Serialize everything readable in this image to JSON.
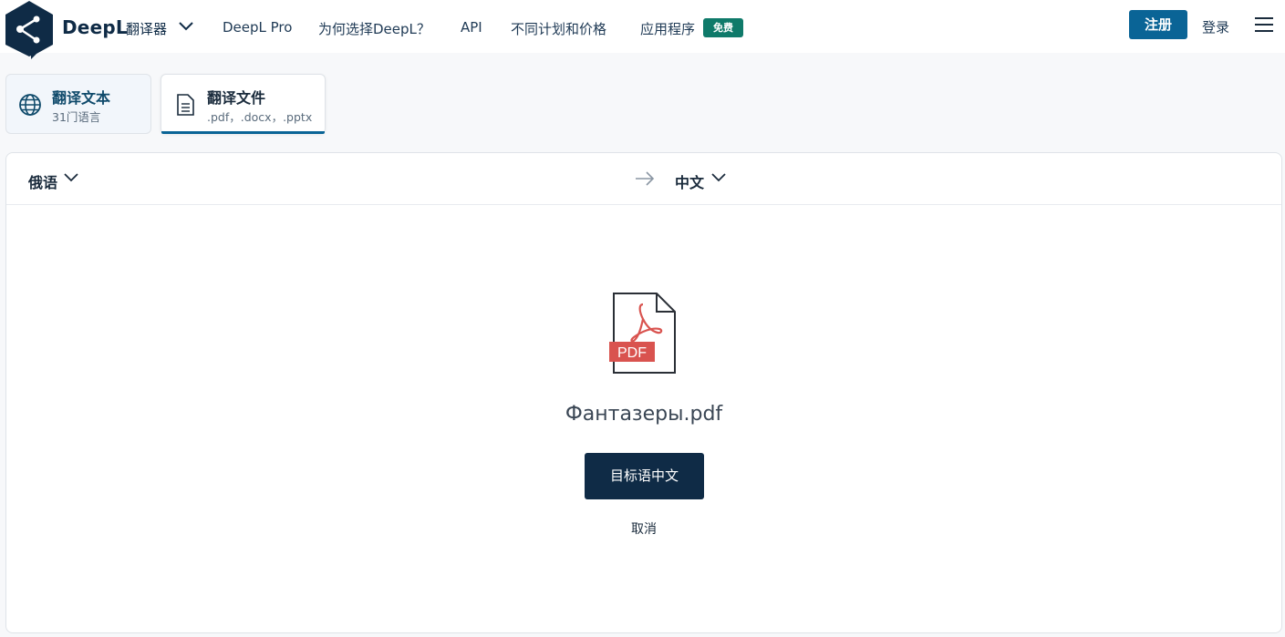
{
  "header": {
    "brand": "DeepL",
    "product": "翻译器",
    "nav": {
      "pro": "DeepL Pro",
      "why": "为何选择DeepL？",
      "api": "API",
      "plans": "不同计划和价格",
      "apps": "应用程序"
    },
    "apps_badge": "免费",
    "signup_label": "注册",
    "login_label": "登录"
  },
  "tabs": [
    {
      "title": "翻译文本",
      "subtitle": "31门语言",
      "icon": "globe-icon"
    },
    {
      "title": "翻译文件",
      "subtitle": ".pdf，.docx，.pptx",
      "icon": "document-icon"
    }
  ],
  "translator": {
    "source_lang": "俄语",
    "target_lang": "中文",
    "file": {
      "name": "Фантазеры.pdf",
      "type_label": "PDF"
    },
    "translate_button": "目标语中文",
    "cancel_label": "取消"
  },
  "colors": {
    "brand_dark": "#0f2b46",
    "accent_blue": "#0a6496",
    "badge_green": "#0f7a6a",
    "pdf_red": "#d9534f"
  }
}
